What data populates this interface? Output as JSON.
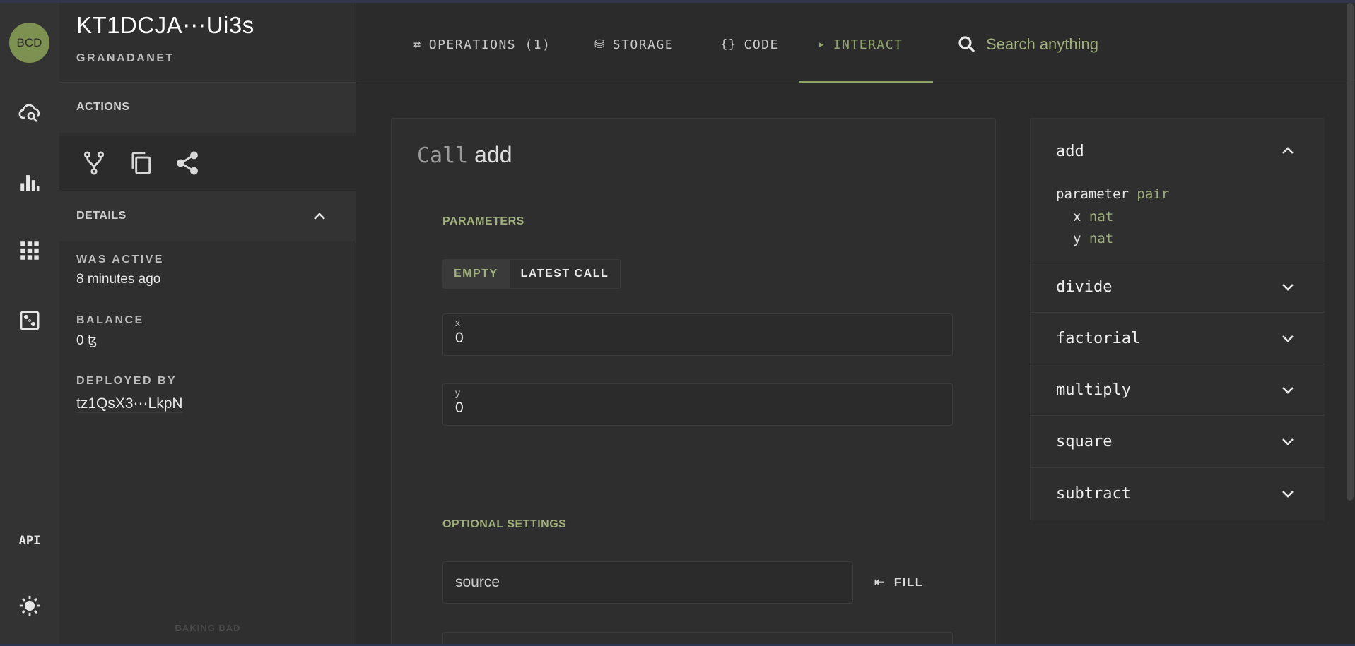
{
  "app": {
    "logo_text": "BCD",
    "api_label": "API",
    "footer_text": "BAKING BAD"
  },
  "contract": {
    "title": "KT1DCJA⋯Ui3s",
    "network": "GRANADANET"
  },
  "sidebar": {
    "actions_label": "ACTIONS",
    "details_label": "DETAILS",
    "was_active_label": "WAS ACTIVE",
    "was_active_value": "8 minutes ago",
    "balance_label": "BALANCE",
    "balance_value": "0 ꜩ",
    "deployed_by_label": "DEPLOYED BY",
    "deployed_by_value": "tz1QsX3⋯LkpN"
  },
  "tabs": [
    {
      "label": "OPERATIONS (1)",
      "icon": "swap-icon",
      "glyph": "⇄"
    },
    {
      "label": "STORAGE",
      "icon": "database-icon",
      "glyph": "⛁"
    },
    {
      "label": "CODE",
      "icon": "braces-icon",
      "glyph": "{}"
    },
    {
      "label": "INTERACT",
      "icon": "play-box-icon",
      "glyph": "▸"
    }
  ],
  "search": {
    "placeholder": "Search anything"
  },
  "call": {
    "keyword": "Call",
    "entrypoint": "add",
    "parameters_label": "PARAMETERS",
    "toggle_empty": "EMPTY",
    "toggle_latest": "LATEST CALL",
    "fields": [
      {
        "label": "x",
        "value": "0"
      },
      {
        "label": "y",
        "value": "0"
      }
    ],
    "optional_label": "OPTIONAL SETTINGS",
    "source_placeholder": "source",
    "fill_label": "FILL",
    "fill_glyph": "⇤"
  },
  "entrypoints": {
    "open": {
      "name": "add",
      "type_line1_kw": "parameter",
      "type_line1_ty": "pair",
      "type_line2_kw": "x",
      "type_line2_ty": "nat",
      "type_line3_kw": "y",
      "type_line3_ty": "nat"
    },
    "items": [
      "divide",
      "factorial",
      "multiply",
      "square",
      "subtract"
    ]
  },
  "colors": {
    "accent": "#8ea36a",
    "logo_bg": "#7d9150",
    "background": "#2b2b2b"
  }
}
